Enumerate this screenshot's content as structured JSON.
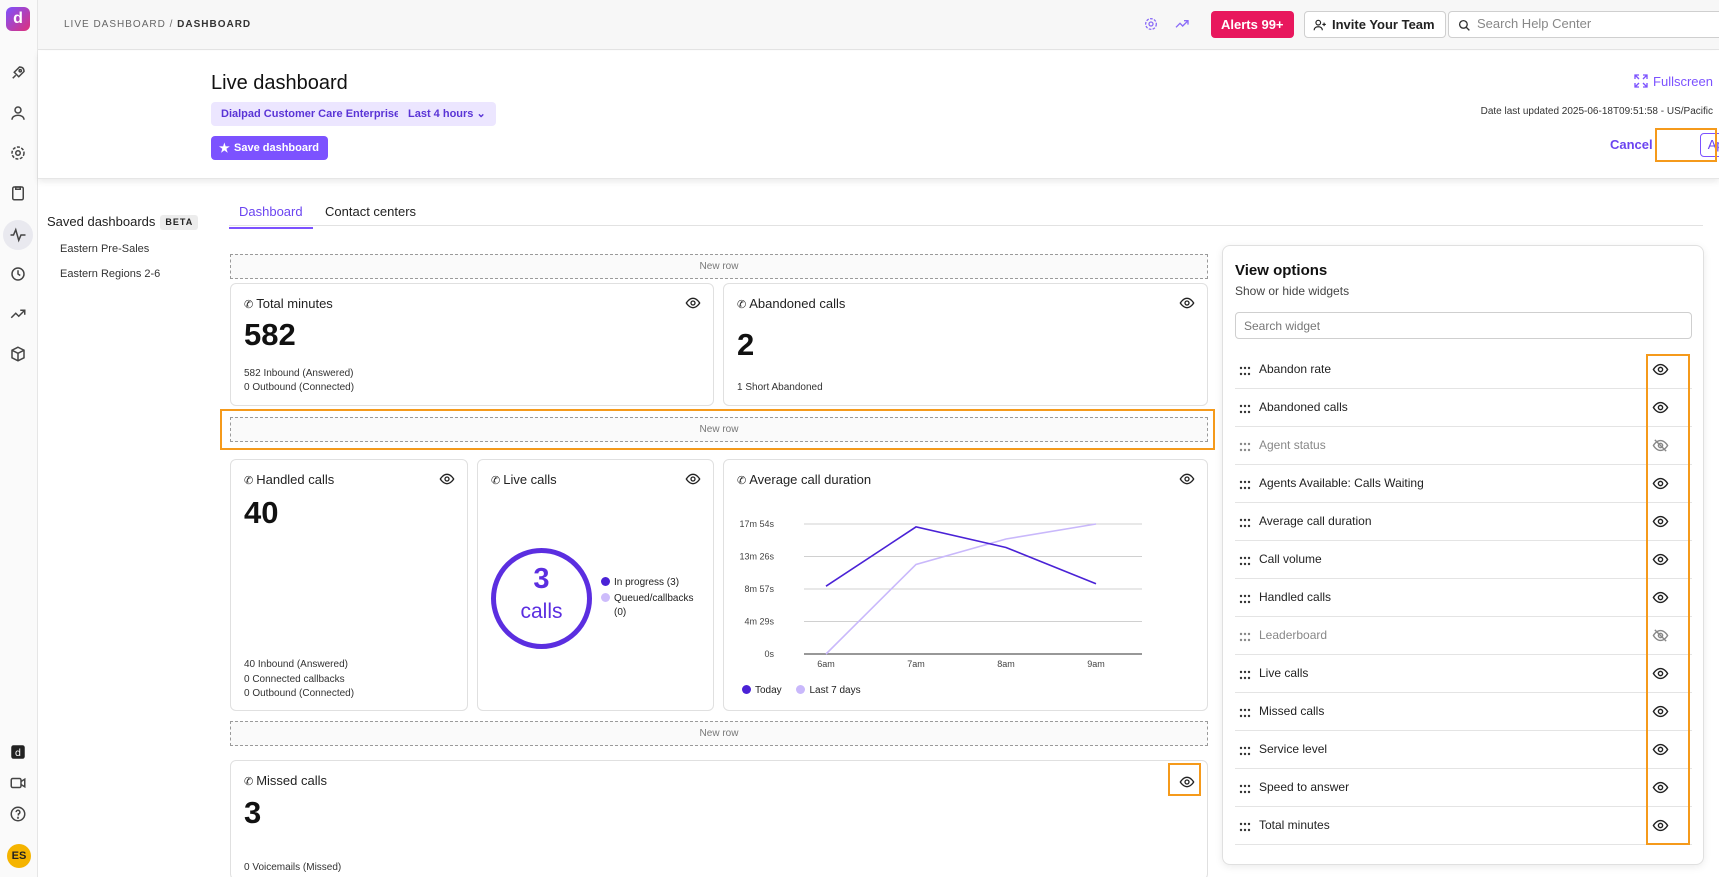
{
  "topbar": {
    "breadcrumb_root": "LIVE DASHBOARD",
    "breadcrumb_sep": " / ",
    "breadcrumb_current": "DASHBOARD",
    "alerts_label": "Alerts 99+",
    "invite_label": "Invite Your Team",
    "search_placeholder": "Search Help Center"
  },
  "rail": {
    "avatar_initials": "ES",
    "icons": [
      "rocket-icon",
      "user-icon",
      "gear-icon",
      "clipboard-icon",
      "pulse-icon",
      "history-icon",
      "trend-icon",
      "cube-icon",
      "dialpad-app-icon",
      "video-icon",
      "help-icon"
    ]
  },
  "header": {
    "title": "Live dashboard",
    "chip_center": "Dialpad Customer Care Enterprise",
    "chip_range": "Last 4 hours",
    "save_label": "Save dashboard",
    "fullscreen_label": "Fullscreen",
    "updated_text": "Date last updated 2025-06-18T09:51:58 - US/Pacific",
    "cancel_label": "Cancel",
    "apply_label": "Apply"
  },
  "saved": {
    "title": "Saved dashboards",
    "beta": "BETA",
    "items": [
      "Eastern Pre-Sales",
      "Eastern Regions 2-6"
    ]
  },
  "tabs": [
    "Dashboard",
    "Contact centers"
  ],
  "new_row_label": "New row",
  "widgets": {
    "total_minutes": {
      "title": "Total minutes",
      "value": "582",
      "line1": "582 Inbound (Answered)",
      "line2": "0 Outbound (Connected)"
    },
    "abandoned_calls": {
      "title": "Abandoned calls",
      "value": "2",
      "line1": "1 Short Abandoned"
    },
    "handled_calls": {
      "title": "Handled calls",
      "value": "40",
      "line1": "40 Inbound (Answered)",
      "line2": "0 Connected callbacks",
      "line3": "0 Outbound (Connected)"
    },
    "live_calls": {
      "title": "Live calls",
      "value": "3",
      "unit": "calls",
      "legend_in_progress": "In progress (3)",
      "legend_queued_1": "Queued/callbacks",
      "legend_queued_2": "(0)"
    },
    "avg_call_duration": {
      "title": "Average call duration",
      "legend_today": "Today",
      "legend_last7": "Last 7 days"
    },
    "missed_calls": {
      "title": "Missed calls",
      "value": "3",
      "line1": "0 Voicemails (Missed)"
    }
  },
  "chart_data": {
    "type": "line",
    "title": "Average call duration",
    "x": [
      "6am",
      "7am",
      "8am",
      "9am"
    ],
    "y_tick_labels": [
      "0s",
      "4m 29s",
      "8m 57s",
      "13m 26s",
      "17m 54s"
    ],
    "y_tick_seconds": [
      0,
      269,
      537,
      806,
      1074
    ],
    "ylim": [
      0,
      1074
    ],
    "grid": true,
    "legend": "bottom-left",
    "series": [
      {
        "name": "Today",
        "color": "#4a22d6",
        "values": [
          560,
          1050,
          880,
          580
        ]
      },
      {
        "name": "Last 7 days",
        "color": "#c9b8fb",
        "values": [
          0,
          740,
          950,
          1074
        ]
      }
    ]
  },
  "view_options": {
    "title": "View options",
    "subtitle": "Show or hide widgets",
    "search_placeholder": "Search widget",
    "items": [
      {
        "label": "Abandon rate",
        "visible": true
      },
      {
        "label": "Abandoned calls",
        "visible": true
      },
      {
        "label": "Agent status",
        "visible": false
      },
      {
        "label": "Agents Available: Calls Waiting",
        "visible": true
      },
      {
        "label": "Average call duration",
        "visible": true
      },
      {
        "label": "Call volume",
        "visible": true
      },
      {
        "label": "Handled calls",
        "visible": true
      },
      {
        "label": "Leaderboard",
        "visible": false
      },
      {
        "label": "Live calls",
        "visible": true
      },
      {
        "label": "Missed calls",
        "visible": true
      },
      {
        "label": "Service level",
        "visible": true
      },
      {
        "label": "Speed to answer",
        "visible": true
      },
      {
        "label": "Total minutes",
        "visible": true
      }
    ]
  },
  "colors": {
    "accent": "#7c52ff",
    "alerts": "#e8175d",
    "highlight": "#f59a1b"
  }
}
